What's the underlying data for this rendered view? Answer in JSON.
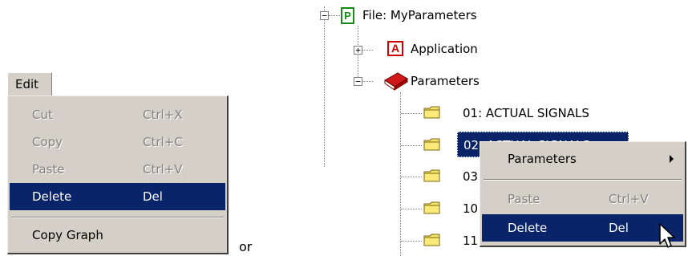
{
  "edit_menu": {
    "title": "Edit",
    "items": [
      {
        "label": "Cut",
        "shortcut": "Ctrl+X"
      },
      {
        "label": "Copy",
        "shortcut": "Ctrl+C"
      },
      {
        "label": "Paste",
        "shortcut": "Ctrl+V"
      },
      {
        "label": "Delete",
        "shortcut": "Del"
      }
    ],
    "copy_graph": "Copy Graph"
  },
  "or_text": "or",
  "tree": {
    "root": {
      "icon_letter": "P",
      "label": "File: MyParameters"
    },
    "application": {
      "icon_letter": "A",
      "label": "Application"
    },
    "parameters": {
      "label": "Parameters"
    },
    "folders": [
      {
        "label": "01: ACTUAL SIGNALS"
      },
      {
        "label": "02: ACTUAL SIGNALS"
      },
      {
        "label": "03"
      },
      {
        "label": "10"
      },
      {
        "label": "11"
      }
    ]
  },
  "context_menu": {
    "parameters": "Parameters",
    "paste": {
      "label": "Paste",
      "shortcut": "Ctrl+V"
    },
    "delete": {
      "label": "Delete",
      "shortcut": "Del"
    }
  },
  "colors": {
    "menu_bg": "#d4d0c8",
    "selection": "#0a246a",
    "disabled_text": "#808080",
    "folder_yellow": "#f4e26a",
    "root_icon": "#1a8a1a",
    "app_icon": "#d00000"
  }
}
